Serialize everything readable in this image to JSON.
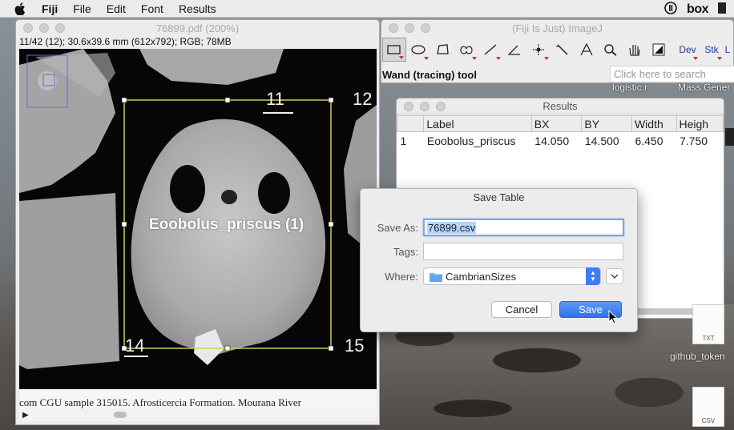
{
  "menubar": {
    "items": [
      "Fiji",
      "File",
      "Edit",
      "Font",
      "Results"
    ],
    "box_label": "box"
  },
  "image_window": {
    "title": "76899.pdf (200%)",
    "info": "11/42 (12); 30.6x39.6 mm (612x792); RGB; 78MB",
    "overlay_label": "Eoobolus_priscus (1)",
    "specimen_numbers": [
      "11",
      "12",
      "14",
      "15"
    ],
    "caption_fragment": "com CGU sample 315015. Afrosticercia Formation. Mourana River"
  },
  "imagej_window": {
    "title": "(Fiji Is Just) ImageJ",
    "tools": [
      "rectangle-tool",
      "oval-tool",
      "polygon-tool",
      "freehand-tool",
      "line-tool",
      "angle-tool",
      "point-tool",
      "wand-tool",
      "text-tool",
      "magnifier-tool",
      "hand-tool",
      "color-picker-tool"
    ],
    "tool_labels": {
      "dev": "Dev",
      "stk": "Stk",
      "extra": "L"
    },
    "status": "Wand (tracing) tool",
    "search_placeholder": "Click here to search"
  },
  "results_window": {
    "title": "Results",
    "columns": [
      "",
      "Label",
      "BX",
      "BY",
      "Width",
      "Heigh"
    ],
    "rows": [
      [
        "1",
        "Eoobolus_priscus",
        "14.050",
        "14.500",
        "6.450",
        "7.750"
      ]
    ]
  },
  "desktop": {
    "texts": [
      "logistic.r",
      "Mass Gener",
      "github_token"
    ],
    "file_labels": [
      "TXT",
      "CSV"
    ]
  },
  "save_dialog": {
    "title": "Save Table",
    "save_as_label": "Save As:",
    "save_as_value": "76899.csv",
    "tags_label": "Tags:",
    "tags_value": "",
    "where_label": "Where:",
    "where_value": "CambrianSizes",
    "cancel_label": "Cancel",
    "save_label": "Save"
  }
}
